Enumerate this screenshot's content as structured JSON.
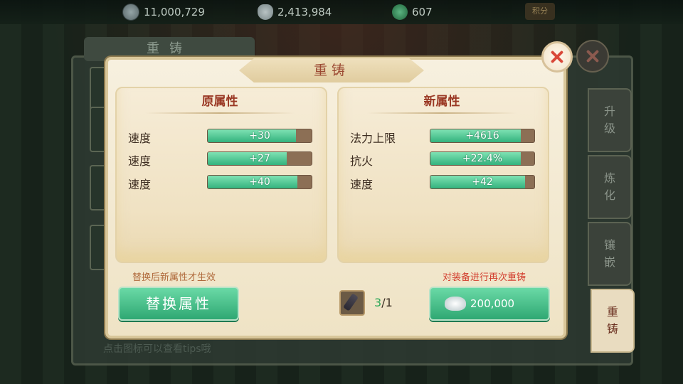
{
  "currencies": [
    {
      "icon": "silver-coin-icon",
      "value": "11,000,729"
    },
    {
      "icon": "silver-ingot-icon",
      "value": "2,413,984"
    },
    {
      "icon": "jade-icon",
      "value": "607"
    }
  ],
  "jifen_label": "积分",
  "back_panel": {
    "title": "重铸",
    "hint": "点击图标可以查看tips哦"
  },
  "side_tabs": [
    "升级",
    "炼化",
    "镶嵌",
    "重铸"
  ],
  "active_tab": "重铸",
  "dialog": {
    "title": "重铸",
    "old": {
      "title": "原属性",
      "attrs": [
        {
          "name": "速度",
          "value": "+30",
          "fill": 0.85
        },
        {
          "name": "速度",
          "value": "+27",
          "fill": 0.76
        },
        {
          "name": "速度",
          "value": "+40",
          "fill": 0.86
        }
      ]
    },
    "new": {
      "title": "新属性",
      "attrs": [
        {
          "name": "法力上限",
          "value": "+4616",
          "fill": 0.87
        },
        {
          "name": "抗火",
          "value": "+22.4%",
          "fill": 0.87
        },
        {
          "name": "速度",
          "value": "+42",
          "fill": 0.91
        }
      ]
    },
    "note_left": "替换后新属性才生效",
    "note_right": "对装备进行再次重铸",
    "replace_button": "替换属性",
    "material": {
      "have": "3",
      "need": "1"
    },
    "recast_price": "200,000"
  },
  "colors": {
    "accent_green": "#33b27d",
    "title_red": "#9a3824",
    "warning_red": "#d23c2c"
  }
}
